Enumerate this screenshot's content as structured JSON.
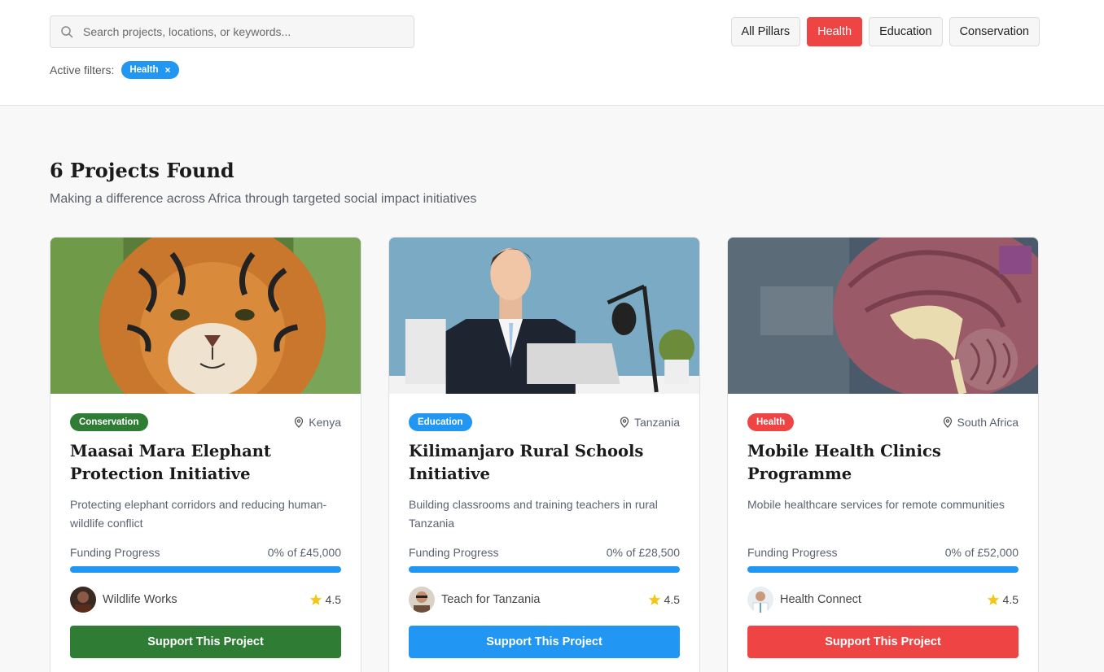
{
  "search": {
    "placeholder": "Search projects, locations, or keywords..."
  },
  "pillars": [
    {
      "label": "All Pillars",
      "active": false
    },
    {
      "label": "Health",
      "active": true
    },
    {
      "label": "Education",
      "active": false
    },
    {
      "label": "Conservation",
      "active": false
    }
  ],
  "filters": {
    "label": "Active filters:",
    "chips": [
      {
        "label": "Health",
        "remove": "×"
      }
    ]
  },
  "results": {
    "heading": "6 Projects Found",
    "subheading": "Making a difference across Africa through targeted social impact initiatives"
  },
  "colors": {
    "conservation": "#2f7d34",
    "education": "#2196f3",
    "health": "#ef4444",
    "progress": "#2196f3",
    "star": "#f5c518"
  },
  "cards": [
    {
      "image": "tiger-photo",
      "tag": "Conservation",
      "tag_color": "#2f7d34",
      "location": "Kenya",
      "title": "Maasai Mara Elephant Protection Initiative",
      "description": "Protecting elephant corridors and reducing human-wildlife conflict",
      "progress_label": "Funding Progress",
      "progress_text": "0% of £45,000",
      "progress_fraction": 1.0,
      "organization": "Wildlife Works",
      "rating": "4.5",
      "button": "Support This Project",
      "button_color": "#2f7d34"
    },
    {
      "image": "businessman-photo",
      "tag": "Education",
      "tag_color": "#2196f3",
      "location": "Tanzania",
      "title": "Kilimanjaro Rural Schools Initiative",
      "description": "Building classrooms and training teachers in rural Tanzania",
      "progress_label": "Funding Progress",
      "progress_text": "0% of £28,500",
      "progress_fraction": 1.0,
      "organization": "Teach for Tanzania",
      "rating": "4.5",
      "button": "Support This Project",
      "button_color": "#2196f3"
    },
    {
      "image": "brain-model-photo",
      "tag": "Health",
      "tag_color": "#ef4444",
      "location": "South Africa",
      "title": "Mobile Health Clinics Programme",
      "description": "Mobile healthcare services for remote communities",
      "progress_label": "Funding Progress",
      "progress_text": "0% of £52,000",
      "progress_fraction": 1.0,
      "organization": "Health Connect",
      "rating": "4.5",
      "button": "Support This Project",
      "button_color": "#ef4444"
    }
  ]
}
